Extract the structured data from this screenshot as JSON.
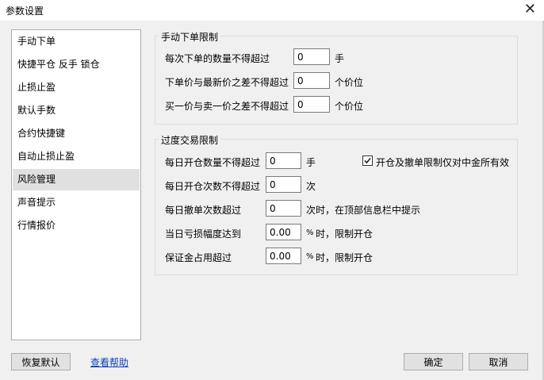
{
  "window": {
    "title": "参数设置",
    "close_glyph": "✕"
  },
  "sidebar": {
    "items": [
      {
        "label": "手动下单"
      },
      {
        "label": "快捷平仓 反手 锁仓"
      },
      {
        "label": "止损止盈"
      },
      {
        "label": "默认手数"
      },
      {
        "label": "合约快捷键"
      },
      {
        "label": "自动止损止盈"
      },
      {
        "label": "风险管理",
        "selected": true
      },
      {
        "label": "声音提示"
      },
      {
        "label": "行情报价"
      }
    ]
  },
  "manual_group": {
    "title": "手动下单限制",
    "rows": [
      {
        "label": "每次下单的数量不得超过",
        "value": "0",
        "unit": "手"
      },
      {
        "label": "下单价与最新价之差不得超过",
        "value": "0",
        "unit": "个价位"
      },
      {
        "label": "买一价与卖一价之差不得超过",
        "value": "0",
        "unit": "个价位"
      }
    ]
  },
  "excess_group": {
    "title": "过度交易限制",
    "rows": [
      {
        "label": "每日开仓数量不得超过",
        "value": "0",
        "unit": "手"
      },
      {
        "label": "每日开仓次数不得超过",
        "value": "0",
        "unit": "次"
      },
      {
        "label": "每日撤单次数超过",
        "value": "0",
        "unit": "次时，在顶部信息栏中提示"
      },
      {
        "label": "当日亏损幅度达到",
        "value": "0.00",
        "unit_pct": "%",
        "unit": "时，限制开仓"
      },
      {
        "label": "保证金占用超过",
        "value": "0.00",
        "unit_pct": "%",
        "unit": "时，限制开仓"
      }
    ],
    "checkbox": {
      "label": "开仓及撤单限制仅对中金所有效",
      "checked": true
    }
  },
  "footer": {
    "restore_label": "恢复默认",
    "help_label": "查看帮助",
    "ok_label": "确定",
    "cancel_label": "取消"
  }
}
